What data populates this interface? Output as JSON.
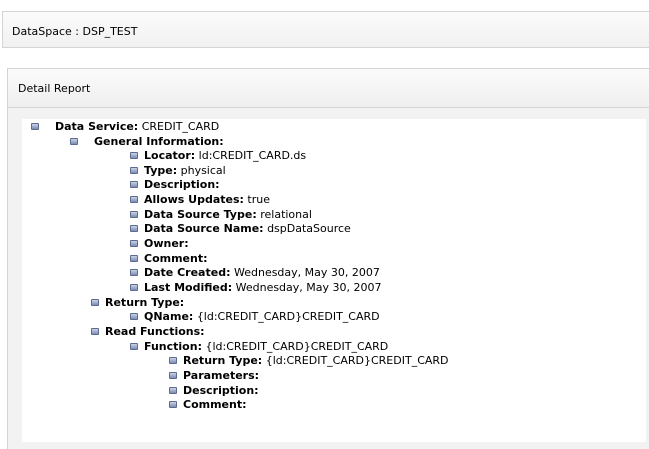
{
  "dataspace": {
    "title": "DataSpace : DSP_TEST"
  },
  "report": {
    "title": "Detail Report",
    "tree": [
      {
        "label": "Data Service:",
        "value": "CREDIT_CARD"
      },
      {
        "label": "General Information:",
        "value": ""
      },
      {
        "label": "Locator:",
        "value": "ld:CREDIT_CARD.ds"
      },
      {
        "label": "Type:",
        "value": "physical"
      },
      {
        "label": "Description:",
        "value": ""
      },
      {
        "label": "Allows Updates:",
        "value": "true"
      },
      {
        "label": "Data Source Type:",
        "value": "relational"
      },
      {
        "label": "Data Source Name:",
        "value": "dspDataSource"
      },
      {
        "label": "Owner:",
        "value": ""
      },
      {
        "label": "Comment:",
        "value": ""
      },
      {
        "label": "Date Created:",
        "value": "Wednesday, May 30, 2007"
      },
      {
        "label": "Last Modified:",
        "value": "Wednesday, May 30, 2007"
      },
      {
        "label": "Return Type:",
        "value": ""
      },
      {
        "label": "QName:",
        "value": "{ld:CREDIT_CARD}CREDIT_CARD"
      },
      {
        "label": "Read Functions:",
        "value": ""
      },
      {
        "label": "Function:",
        "value": "{ld:CREDIT_CARD}CREDIT_CARD"
      },
      {
        "label": "Return Type:",
        "value": "{ld:CREDIT_CARD}CREDIT_CARD"
      },
      {
        "label": "Parameters:",
        "value": ""
      },
      {
        "label": "Description:",
        "value": ""
      },
      {
        "label": "Comment:",
        "value": ""
      }
    ]
  }
}
